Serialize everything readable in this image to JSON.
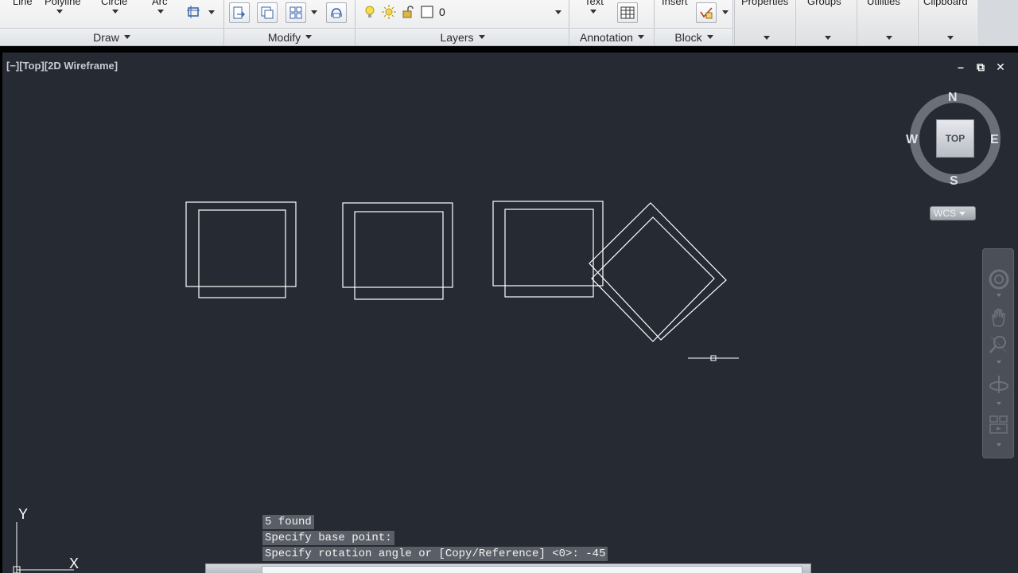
{
  "ribbon": {
    "draw": {
      "title": "Draw",
      "tools": [
        "Line",
        "Polyline",
        "Circle",
        "Arc"
      ]
    },
    "modify": {
      "title": "Modify"
    },
    "layers": {
      "title": "Layers",
      "current_layer": "0"
    },
    "annotation": {
      "title": "Annotation",
      "text_label": "Text"
    },
    "block": {
      "title": "Block",
      "insert_label": "Insert"
    },
    "extra_panels": [
      "Properties",
      "Groups",
      "Utilities",
      "Clipboard"
    ]
  },
  "viewport": {
    "label": "[−][Top][2D Wireframe]",
    "controls": {
      "minimize": "–",
      "restore": "⧉",
      "close": "✕"
    }
  },
  "viewcube": {
    "north": "N",
    "south": "S",
    "east": "E",
    "west": "W",
    "face": "TOP",
    "wcs": "WCS"
  },
  "ucs": {
    "y": "Y",
    "x": "X"
  },
  "command": {
    "history": [
      "5 found",
      "Specify base point:",
      "Specify rotation angle or [Copy/Reference] <0>: -45"
    ],
    "input_placeholder": ""
  },
  "colors": {
    "canvas_bg": "#252a33",
    "line": "#ffffff",
    "ribbon_bg": "#eceef1"
  },
  "icons": [
    "rectangle-select-icon",
    "move-icon",
    "copy-icon",
    "array-icon",
    "match-properties-icon",
    "lightbulb-icon",
    "sun-icon",
    "lock-icon",
    "color-square-icon",
    "table-icon",
    "edit-attribute-icon",
    "steeringwheel-icon",
    "pan-icon",
    "zoom-icon",
    "orbit-icon",
    "showmotion-icon"
  ]
}
